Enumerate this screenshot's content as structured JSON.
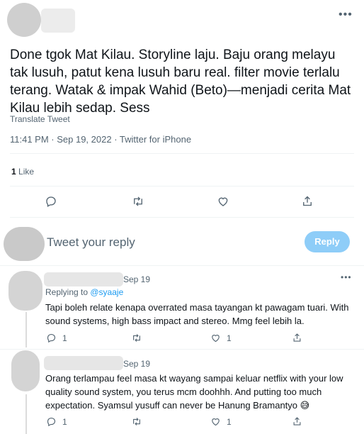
{
  "tweet": {
    "text": "Done tgok Mat Kilau. Storyline laju. Baju orang melayu tak lusuh, patut kena lusuh baru real. filter movie terlalu terang. Watak & impak Wahid (Beto)—menjadi cerita Mat Kilau lebih sedap. Sess",
    "translate_label": "Translate Tweet",
    "timestamp": "11:41 PM · Sep 19, 2022 · Twitter for iPhone",
    "likes_count": "1",
    "likes_label": "Like"
  },
  "composer": {
    "placeholder": "Tweet your reply",
    "reply_button": "Reply"
  },
  "replies": [
    {
      "date": "Sep 19",
      "replying_prefix": "Replying to ",
      "replying_handle": "@syaaje",
      "text": "Tapi boleh relate kenapa overrated masa tayangan kt pawagam tuari. With sound systems, high bass impact and stereo. Mmg feel lebih la.",
      "reply_count": "1",
      "like_count": "1"
    },
    {
      "date": "Sep 19",
      "text": "Orang terlampau feel masa kt wayang sampai keluar netflix with your low quality sound system, you terus mcm doohhh. And putting too much expectation. Syamsul yusuff can never be Hanung Bramantyo 😅",
      "reply_count": "1",
      "like_count": "1"
    }
  ],
  "icons": {
    "more": "more-icon",
    "reply": "reply-icon",
    "retweet": "retweet-icon",
    "like": "like-icon",
    "share": "share-icon"
  },
  "colors": {
    "accent": "#1d9bf0",
    "reply_button": "#8ecdf8",
    "muted": "#536471"
  }
}
